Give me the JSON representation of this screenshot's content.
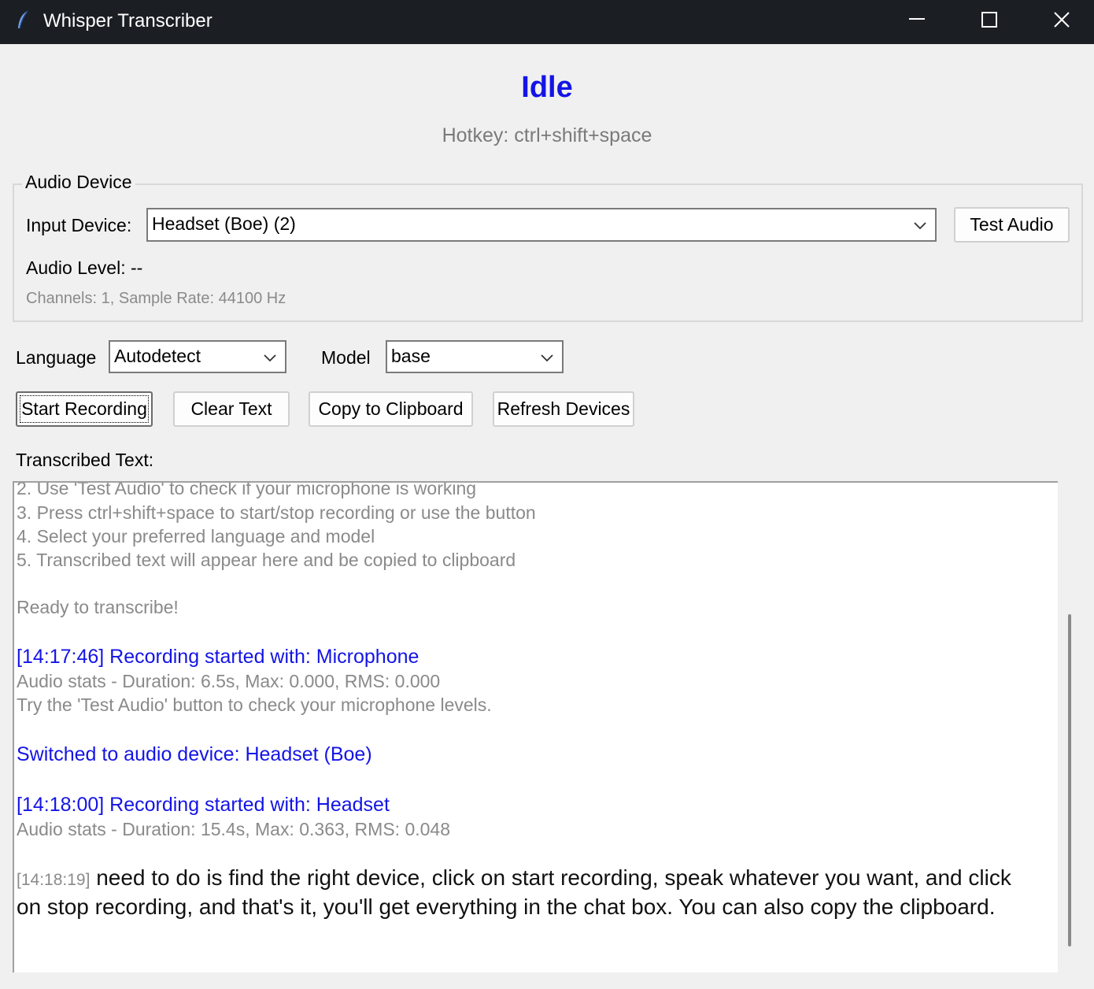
{
  "window": {
    "title": "Whisper Transcriber",
    "icon": "feather-icon",
    "controls": [
      "minimize-icon",
      "maximize-icon",
      "close-icon"
    ]
  },
  "status": {
    "text": "Idle",
    "color": "#1414e6",
    "hotkey": "Hotkey: ctrl+shift+space"
  },
  "audio_device": {
    "group_title": "Audio Device",
    "input_label": "Input Device:",
    "input_value": "Headset (Boe) (2)",
    "test_button": "Test Audio",
    "level_text": "Audio Level: --",
    "info_text": "Channels: 1, Sample Rate: 44100 Hz"
  },
  "options": {
    "language_label": "Language",
    "language_value": "Autodetect",
    "model_label": "Model",
    "model_value": "base"
  },
  "buttons": {
    "start": "Start Recording",
    "clear": "Clear Text",
    "copy": "Copy to Clipboard",
    "refresh": "Refresh Devices"
  },
  "transcribed": {
    "label": "Transcribed Text:",
    "lines": [
      "2. Use 'Test Audio' to check if your microphone is working",
      "3. Press ctrl+shift+space to start/stop recording or use the button",
      "4. Select your preferred language and model",
      "5. Transcribed text will appear here and be copied to clipboard",
      "Ready to transcribe!",
      "[14:17:46] Recording started with: Microphone",
      "Audio stats - Duration: 6.5s, Max: 0.000, RMS: 0.000",
      "Try the 'Test Audio' button to check your microphone levels.",
      "Switched to audio device: Headset (Boe)",
      "[14:18:00] Recording started with: Headset",
      "Audio stats - Duration: 15.4s, Max: 0.363, RMS: 0.048"
    ],
    "final_timestamp": "[14:18:19]",
    "final_text": "need to do is find the right device, click on start recording, speak whatever you want, and click on stop recording, and that's it, you'll get everything in the chat box. You can also copy the clipboard."
  }
}
